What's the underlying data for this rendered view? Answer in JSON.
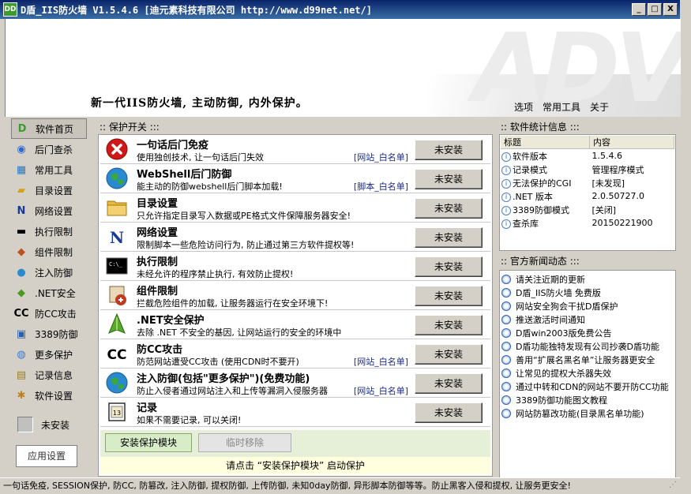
{
  "window": {
    "app_icon_text": "DD",
    "title": "D盾_IIS防火墙 V1.5.4.6 [迪元素科技有限公司 http://www.d99net.net/]",
    "btn_min": "_",
    "btn_max": "□",
    "btn_close": "X"
  },
  "header": {
    "bg_logo": "ADV",
    "slogan": "新一代IIS防火墙, 主动防御, 内外保护。",
    "menu": [
      "选项",
      "常用工具",
      "关于"
    ]
  },
  "sidebar": {
    "items": [
      {
        "label": "软件首页",
        "icon": "home-icon",
        "glyph": "D",
        "color": "#3d9a2f"
      },
      {
        "label": "后门查杀",
        "icon": "backdoor-scan-icon",
        "glyph": "◉",
        "color": "#2a6ad0"
      },
      {
        "label": "常用工具",
        "icon": "tools-icon",
        "glyph": "▦",
        "color": "#2a7ac0"
      },
      {
        "label": "目录设置",
        "icon": "folder-icon",
        "glyph": "▰",
        "color": "#d4a020"
      },
      {
        "label": "网络设置",
        "icon": "network-icon",
        "glyph": "N",
        "color": "#1a3a9a"
      },
      {
        "label": "执行限制",
        "icon": "terminal-icon",
        "glyph": "▬",
        "color": "#000000"
      },
      {
        "label": "组件限制",
        "icon": "component-icon",
        "glyph": "◆",
        "color": "#c05020"
      },
      {
        "label": "注入防御",
        "icon": "globe-icon",
        "glyph": "●",
        "color": "#2a8ad0"
      },
      {
        "label": ".NET安全",
        "icon": "dotnet-icon",
        "glyph": "◆",
        "color": "#4a9a20"
      },
      {
        "label": "防CC攻击",
        "icon": "cc-icon",
        "glyph": "CC",
        "color": "#000000"
      },
      {
        "label": "3389防御",
        "icon": "remote-desktop-icon",
        "glyph": "▣",
        "color": "#2a60b0"
      },
      {
        "label": "更多保护",
        "icon": "more-protection-icon",
        "glyph": "◍",
        "color": "#3a7ad0"
      },
      {
        "label": "记录信息",
        "icon": "log-icon",
        "glyph": "▤",
        "color": "#a08020"
      },
      {
        "label": "软件设置",
        "icon": "settings-icon",
        "glyph": "✱",
        "color": "#c08020"
      }
    ],
    "status": "未安装",
    "apply_button": "应用设置"
  },
  "protection": {
    "section_title": ":: 保护开关 :::",
    "modules": [
      {
        "title": "一句话后门免疫",
        "desc": "使用独创技术, 让一句话后门失效",
        "link": "[网站_白名单]",
        "button": "未安装",
        "icon": "block-icon"
      },
      {
        "title": "WebShell后门防御",
        "desc": "能主动的防御webshell后门脚本加载!",
        "link": "[脚本_白名单]",
        "button": "未安装",
        "icon": "globe-icon"
      },
      {
        "title": "目录设置",
        "desc": "只允许指定目录写入数据或PE格式文件保障服务器安全!",
        "link": "",
        "button": "未安装",
        "icon": "folder-icon"
      },
      {
        "title": "网络设置",
        "desc": "限制脚本一些危险访问行为, 防止通过第三方软件提权等!",
        "link": "",
        "button": "未安装",
        "icon": "network-icon"
      },
      {
        "title": "执行限制",
        "desc": "未经允许的程序禁止执行, 有效防止提权!",
        "link": "",
        "button": "未安装",
        "icon": "terminal-icon"
      },
      {
        "title": "组件限制",
        "desc": "拦截危险组件的加载, 让服务器运行在安全环境下!",
        "link": "",
        "button": "未安装",
        "icon": "component-icon"
      },
      {
        "title": ".NET安全保护",
        "desc": "去除 .NET 不安全的基因, 让网站运行的安全的环境中",
        "link": "",
        "button": "未安装",
        "icon": "dotnet-icon"
      },
      {
        "title": "防CC攻击",
        "desc": "防范网站遭受CC攻击 (使用CDN时不要开)",
        "link": "[网站_白名单]",
        "button": "未安装",
        "icon": "cc-icon"
      },
      {
        "title": "注入防御(包括\"更多保护\")(免费功能)",
        "desc": "防止入侵者通过网站注入和上传等漏洞入侵服务器",
        "link": "[网站_白名单]",
        "button": "未安装",
        "icon": "globe-icon"
      },
      {
        "title": "记录",
        "desc": "如果不需要记录, 可以关闭!",
        "link": "",
        "button": "未安装",
        "icon": "log-icon"
      }
    ],
    "install_button": "安装保护模块",
    "remove_button": "临时移除",
    "hint": "请点击 “安装保护模块” 启动保护"
  },
  "stats": {
    "section_title": ":: 软件统计信息 :::",
    "columns": [
      "标题",
      "内容"
    ],
    "rows": [
      {
        "k": "软件版本",
        "v": "1.5.4.6"
      },
      {
        "k": "记录模式",
        "v": "管理程序模式"
      },
      {
        "k": "无法保护的CGI",
        "v": "[未发现]"
      },
      {
        "k": ".NET 版本",
        "v": "2.0.50727.0"
      },
      {
        "k": "3389防御模式",
        "v": "[关闭]"
      },
      {
        "k": "查杀库",
        "v": "20150221900"
      }
    ]
  },
  "news": {
    "section_title": ":: 官方新闻动态 :::",
    "items": [
      "请关注近期的更新",
      "D盾_IIS防火墙 免费版",
      "网站安全狗会干扰D盾保护",
      "推送激活时间通知",
      "D盾win2003版免费公告",
      "D盾功能独特发现有公司抄袭D盾功能",
      "善用“扩展名黑名单”让服务器更安全",
      "让常见的提权大杀器失效",
      "通过中转和CDN的网站不要开防CC功能",
      "3389防御功能图文教程",
      "网站防篡改功能(目录黑名单功能)"
    ]
  },
  "statusbar": "一句话免疫, SESSION保护, 防CC, 防篡改, 注入防御, 提权防御, 上传防御, 未知0day防御, 异形脚本防御等等。防止黑客入侵和提权, 让服务更安全!",
  "colors": {
    "accent": "#0a246a",
    "link": "#1a2a8a",
    "install_green": "#d9ecc8"
  }
}
